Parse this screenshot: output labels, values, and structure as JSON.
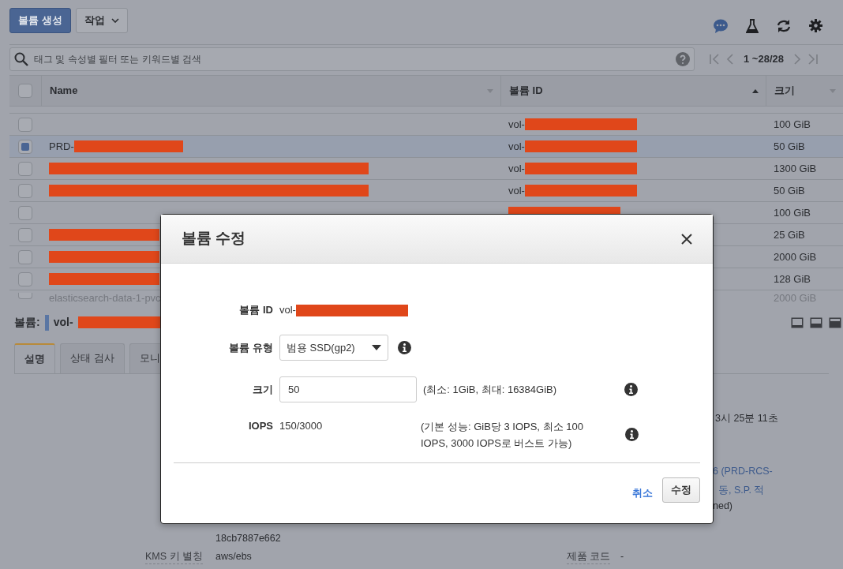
{
  "toolbar": {
    "create_button": "볼륨 생성",
    "actions_button": "작업"
  },
  "search": {
    "placeholder": "태그 및 속성별 필터 또는 키워드별 검색",
    "pagination": "1 ~28/28"
  },
  "table": {
    "select_all_checked": false,
    "columns": [
      {
        "label": "Name",
        "sorted": false
      },
      {
        "label": "볼륨 ID",
        "sorted": true
      },
      {
        "label": "크기",
        "sorted": false
      }
    ],
    "rows": [
      {
        "name": "",
        "volume_id": "vol-",
        "id_redacted": true,
        "size": "100 GiB",
        "selected": false
      },
      {
        "name": "PRD-",
        "name_redacted": true,
        "volume_id": "vol-",
        "id_redacted": true,
        "size": "50 GiB",
        "selected": true
      },
      {
        "name": "",
        "name_redacted": true,
        "volume_id": "vol-",
        "id_redacted": true,
        "size": "1300 GiB",
        "selected": false
      },
      {
        "name": "",
        "name_redacted": true,
        "volume_id": "vol-",
        "id_redacted": true,
        "size": "50 GiB",
        "selected": false
      },
      {
        "name": "",
        "volume_id": "",
        "id_redacted": true,
        "size": "100 GiB",
        "selected": false
      },
      {
        "name": "",
        "name_redacted": true,
        "volume_id": "",
        "size": "25 GiB",
        "selected": false
      },
      {
        "name": "",
        "name_redacted": true,
        "volume_id": "",
        "size": "2000 GiB",
        "selected": false
      },
      {
        "name": "",
        "name_redacted": true,
        "volume_id": "",
        "size": "128 GiB",
        "selected": false
      },
      {
        "name": "elasticsearch-data-1-pvc",
        "volume_id": "",
        "size": "2000 GiB",
        "selected": false,
        "faded": true
      }
    ]
  },
  "detail": {
    "label": "볼륨:",
    "volume_id": "vol-",
    "id_redacted": true,
    "tabs": [
      {
        "label": "설명",
        "selected": true
      },
      {
        "label": "상태 검사",
        "selected": false
      },
      {
        "label": "모니",
        "selected": false
      }
    ],
    "fragments": [
      {
        "text": "3시 25분 11초",
        "kind": "plain"
      },
      {
        "text": "6 (PRD-RCS-",
        "kind": "link"
      },
      {
        "text": "동, S.P. 적",
        "kind": "link"
      },
      {
        "text": "ned)",
        "kind": "plain"
      }
    ],
    "fields": [
      {
        "value": "18cb7887e662"
      },
      {
        "label": "KMS 키 별칭",
        "value": "aws/ebs"
      }
    ],
    "right_fields": [
      {
        "label": "제품 코드",
        "value": "-"
      }
    ]
  },
  "modal": {
    "title": "볼륨 수정",
    "volume_id_label": "볼륨 ID",
    "volume_id": "vol-",
    "id_redacted": true,
    "type_label": "볼륨 유형",
    "type_value": "범용 SSD(gp2)",
    "size_label": "크기",
    "size_value": "50",
    "size_hint": "(최소: 1GiB, 최대: 16384GiB)",
    "iops_label": "IOPS",
    "iops_value": "150/3000",
    "iops_hint": "(기본 성능: GiB당 3 IOPS, 최소 100 IOPS, 3000 IOPS로 버스트 가능)",
    "cancel": "취소",
    "submit": "수정"
  }
}
